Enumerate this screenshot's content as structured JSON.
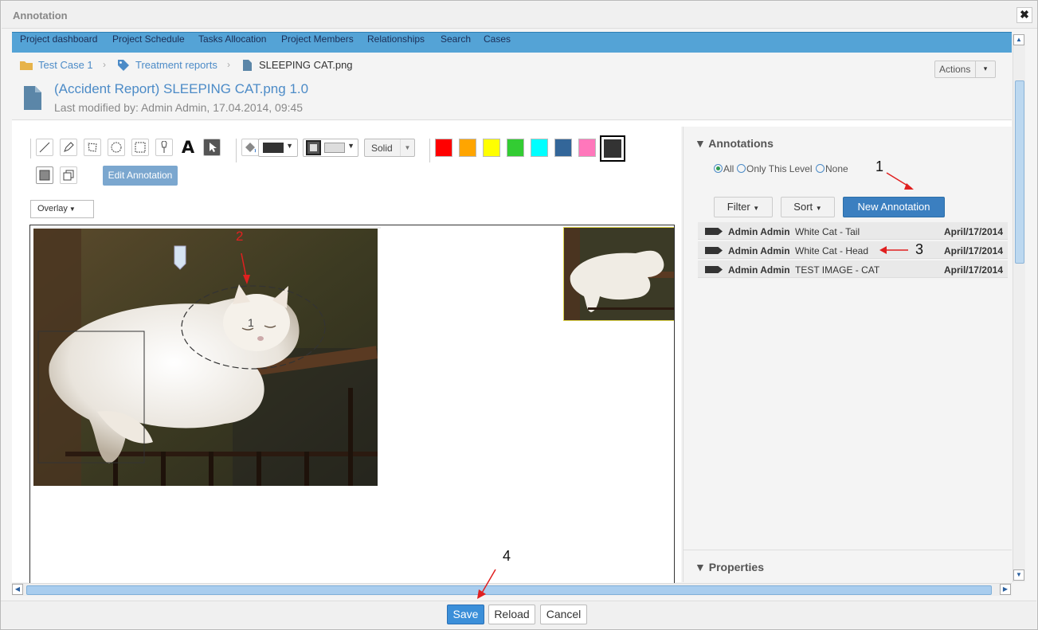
{
  "dialog": {
    "title": "Annotation",
    "close_label": "✖"
  },
  "nav": {
    "items": [
      "Project dashboard",
      "Project Schedule",
      "Tasks Allocation",
      "Project Members",
      "Relationships",
      "Search",
      "Cases"
    ]
  },
  "breadcrumb": {
    "items": [
      "Test Case 1",
      "Treatment reports",
      "SLEEPING CAT.png"
    ]
  },
  "document": {
    "title": "(Accident Report) SLEEPING CAT.png",
    "version": "1.0",
    "modified": "Last modified by: Admin Admin, 17.04.2014, 09:45"
  },
  "actions": {
    "label": "Actions",
    "caret": "▾"
  },
  "toolbar": {
    "edit_annotation": "Edit Annotation",
    "line_style": "Solid",
    "overlay": "Overlay",
    "text_tool": "A",
    "palette": [
      "#ff0000",
      "#ffa500",
      "#ffff00",
      "#33cc33",
      "#00ffff",
      "#336699",
      "#ff77bb",
      "#333333"
    ]
  },
  "canvas": {
    "marker_label": "1"
  },
  "annotations": {
    "heading": "Annotations",
    "filter_all": "All",
    "filter_level": "Only This Level",
    "filter_none": "None",
    "filter_button": "Filter",
    "sort_button": "Sort",
    "new_button": "New Annotation",
    "rows": [
      {
        "author": "Admin Admin",
        "name": "White Cat - Tail",
        "date": "April/17/2014"
      },
      {
        "author": "Admin Admin",
        "name": "White Cat - Head",
        "date": "April/17/2014"
      },
      {
        "author": "Admin Admin",
        "name": "TEST IMAGE - CAT",
        "date": "April/17/2014"
      }
    ]
  },
  "properties": {
    "heading": "Properties"
  },
  "footer": {
    "save": "Save",
    "reload": "Reload",
    "cancel": "Cancel"
  },
  "callouts": {
    "c1": "1",
    "c2": "2",
    "c3": "3",
    "c4": "4"
  }
}
